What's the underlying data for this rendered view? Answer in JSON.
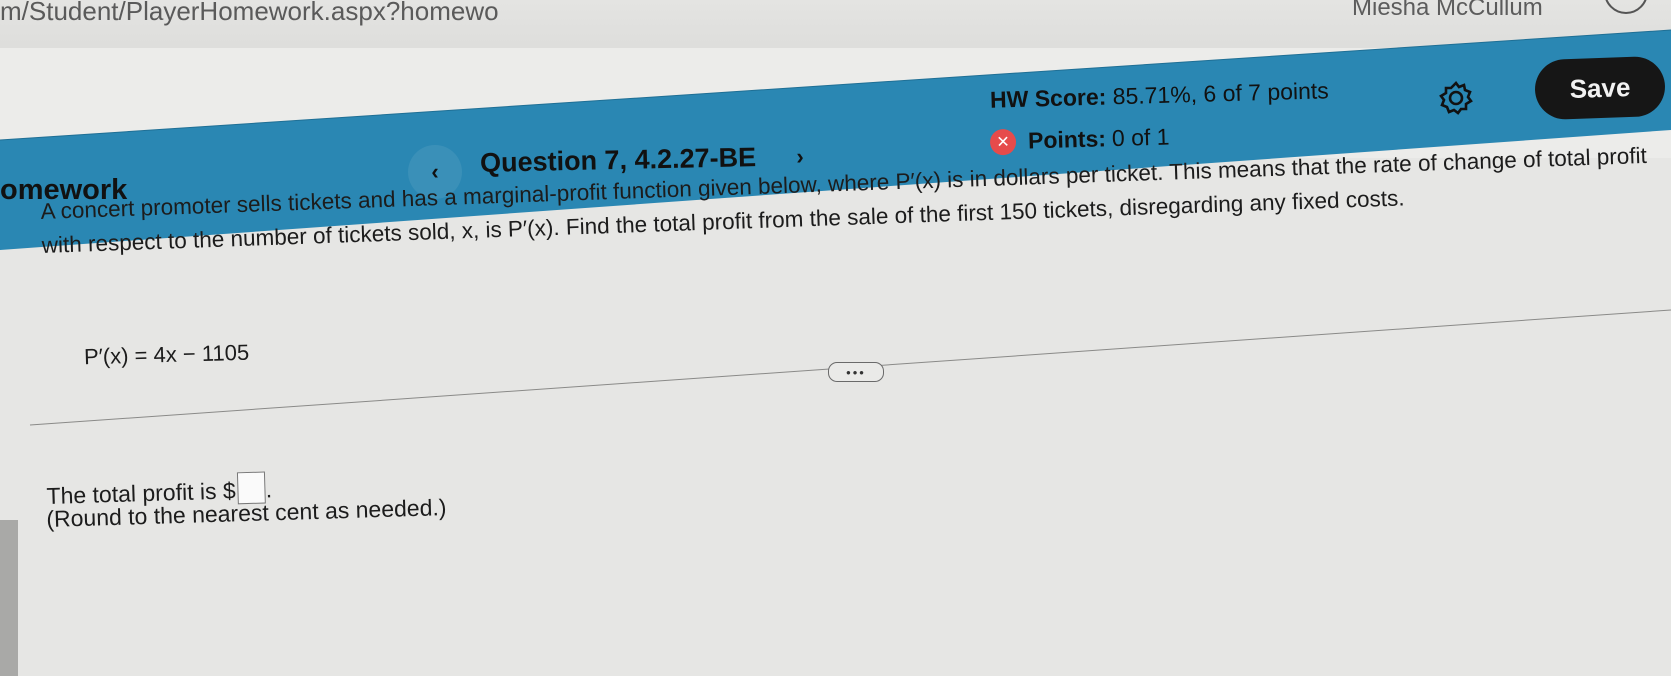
{
  "browser": {
    "url_text": "m/Student/PlayerHomework.aspx?homewo",
    "user_name": "Miesha McCullum"
  },
  "header": {
    "title": "omework",
    "question_label": "Question 7, 4.2.27-BE",
    "prev_icon": "‹",
    "next_icon": "›",
    "hw_score_label": "HW Score:",
    "hw_score_value": "85.71%, 6 of 7 points",
    "points_label": "Points:",
    "points_value": "0 of 1",
    "save_label": "Save",
    "accent_color": "#2a87b3",
    "incorrect_color": "#e64b4b"
  },
  "question": {
    "text": "A concert promoter sells tickets and has a marginal-profit function given below, where P′(x) is in dollars per ticket. This means that the rate of change of total profit with respect to the number of tickets sold, x, is P′(x). Find the total profit from the sale of the first 150 tickets, disregarding any fixed costs.",
    "formula": "P′(x) = 4x − 1105",
    "more_label": "•••",
    "answer_prefix": "The total profit is $",
    "answer_value": "",
    "round_note": "(Round to the nearest cent as needed.)"
  }
}
